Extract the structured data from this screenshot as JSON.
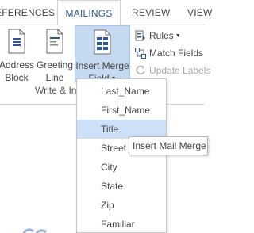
{
  "tabs": [
    {
      "label": "EFERENCES",
      "active": false
    },
    {
      "label": "MAILINGS",
      "active": true
    },
    {
      "label": "REVIEW",
      "active": false
    },
    {
      "label": "VIEW",
      "active": false
    }
  ],
  "ribbon": {
    "address_block": {
      "line1": "Address",
      "line2": "Block",
      "icon": "address-block-icon"
    },
    "greeting_line": {
      "line1": "Greeting",
      "line2": "Line",
      "icon": "greeting-line-icon"
    },
    "insert_merge_field": {
      "line1": "Insert Merge",
      "line2": "Field",
      "icon": "insert-merge-field-icon",
      "state": "pressed"
    },
    "rules": {
      "label": "Rules",
      "icon": "rules-icon"
    },
    "match_fields": {
      "label": "Match Fields",
      "icon": "match-fields-icon"
    },
    "update_labels": {
      "label": "Update Labels",
      "icon": "update-labels-icon",
      "enabled": false
    },
    "group_label": "Write & In"
  },
  "dropdown": {
    "items": [
      "Last_Name",
      "First_Name",
      "Title",
      "Street",
      "City",
      "State",
      "Zip",
      "Familiar"
    ],
    "highlighted": "Title"
  },
  "tooltip": {
    "text": "Insert Mail Merge"
  },
  "colors": {
    "accent": "#2b579a",
    "pressed": "#c5d9f1",
    "hover": "#cde0f7",
    "disabled": "#a6a6a6"
  }
}
